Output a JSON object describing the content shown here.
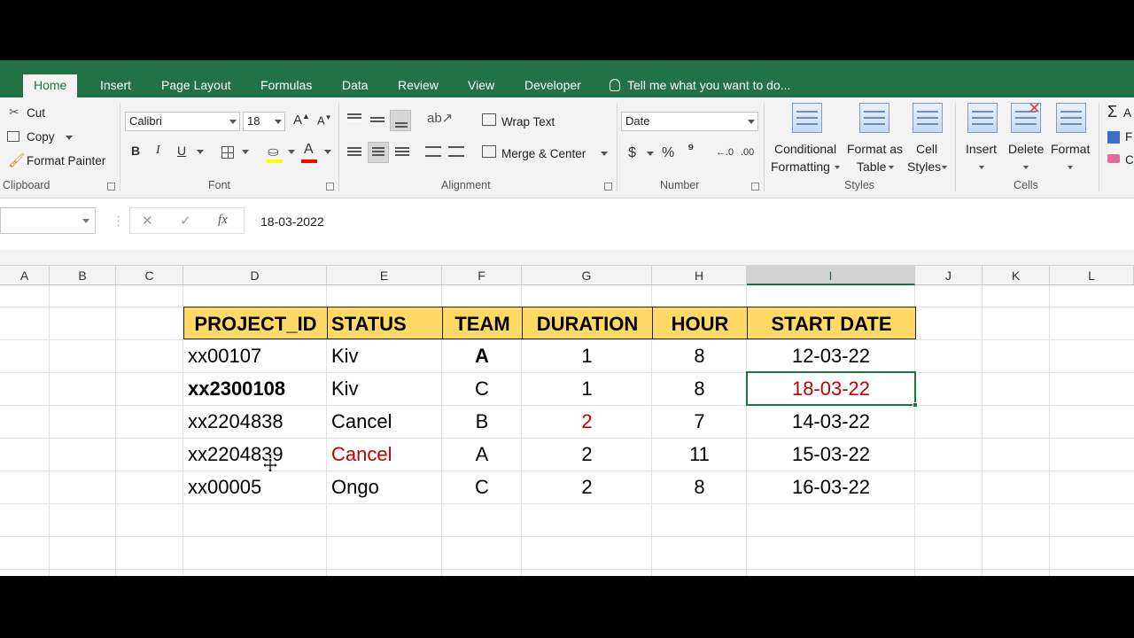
{
  "tabs": [
    "Home",
    "Insert",
    "Page Layout",
    "Formulas",
    "Data",
    "Review",
    "View",
    "Developer"
  ],
  "tell_me": "Tell me what you want to do...",
  "clipboard": {
    "cut": "Cut",
    "copy": "Copy",
    "format_painter": "Format Painter",
    "label": "Clipboard"
  },
  "font": {
    "name": "Calibri",
    "size": "18",
    "bold": "B",
    "italic": "I",
    "underline": "U",
    "grow": "A",
    "shrink": "A",
    "color_a": "A",
    "label": "Font",
    "accent_color": "#ff0000"
  },
  "alignment": {
    "wrap_text": "Wrap Text",
    "merge_center": "Merge & Center",
    "label": "Alignment"
  },
  "number": {
    "format": "Date",
    "currency": "$",
    "percent": "%",
    "comma": "⁹",
    "inc": "←.0",
    "dec": ".00",
    "label": "Number"
  },
  "styles": {
    "conditional_1": "Conditional",
    "conditional_2": "Formatting",
    "format_as_1": "Format as",
    "format_as_2": "Table",
    "cell_1": "Cell",
    "cell_2": "Styles",
    "label": "Styles"
  },
  "cells": {
    "insert": "Insert",
    "delete": "Delete",
    "format": "Format",
    "label": "Cells"
  },
  "editing": {
    "e1": "A",
    "e2": "F",
    "e3": "C"
  },
  "formula_bar": {
    "fx": "fx",
    "content": "18-03-2022"
  },
  "columns": [
    "A",
    "B",
    "C",
    "D",
    "E",
    "F",
    "G",
    "H",
    "I",
    "J",
    "K",
    "L"
  ],
  "selected_column": "I",
  "table": {
    "headers": [
      "PROJECT_ID",
      "STATUS",
      "TEAM",
      "DURATION",
      "HOUR",
      "START DATE"
    ],
    "rows": [
      [
        "xx00107",
        "Kiv",
        "A",
        "1",
        "8",
        "12-03-22"
      ],
      [
        "xx2300108",
        "Kiv",
        "C",
        "1",
        "8",
        "18-03-22"
      ],
      [
        "xx2204838",
        "Cancel",
        "B",
        "2",
        "7",
        "14-03-22"
      ],
      [
        "xx2204839",
        "Cancel",
        "A",
        "2",
        "11",
        "15-03-22"
      ],
      [
        "xx00005",
        "Ongo",
        "C",
        "2",
        "8",
        "16-03-22"
      ]
    ]
  },
  "colors": {
    "excel_green": "#217346",
    "header_fill": "#ffd966",
    "highlight_red": "#c00000"
  }
}
